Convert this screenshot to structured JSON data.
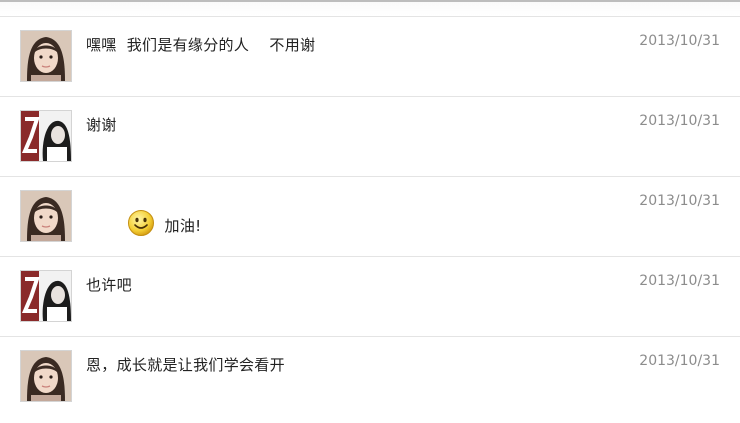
{
  "comments": [
    {
      "avatar": "girl-portrait-avatar",
      "text": "嘿嘿  我们是有缘分的人    不用谢",
      "date": "2013/10/31"
    },
    {
      "avatar": "black-white-girl-avatar",
      "text": "谢谢",
      "date": "2013/10/31"
    },
    {
      "avatar": "girl-portrait-avatar",
      "emoji": "smiley-face-icon",
      "text": "加油!",
      "date": "2013/10/31"
    },
    {
      "avatar": "black-white-girl-avatar",
      "text": "也许吧",
      "date": "2013/10/31"
    },
    {
      "avatar": "girl-portrait-avatar",
      "text": "恩，成长就是让我们学会看开",
      "date": "2013/10/31"
    }
  ],
  "colors": {
    "date": "#8c8c8c",
    "text": "#222222",
    "divider": "#e4e4e4"
  }
}
